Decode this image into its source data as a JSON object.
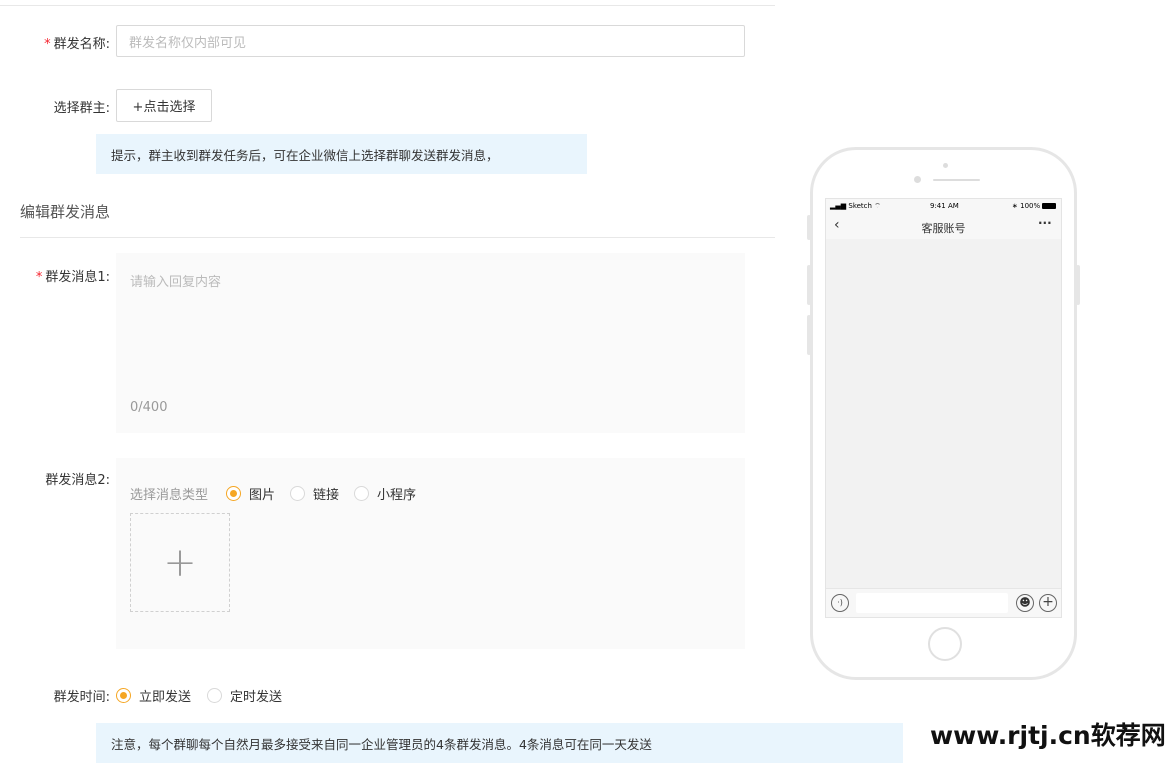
{
  "form": {
    "name_label": "群发名称:",
    "name_placeholder": "群发名称仅内部可见",
    "owner_label": "选择群主:",
    "owner_button": "+点击选择",
    "tip": "提示，群主收到群发任务后，可在企业微信上选择群聊发送群发消息，",
    "section_title": "编辑群发消息",
    "msg1_label": "群发消息1:",
    "msg1_placeholder": "请输入回复内容",
    "msg1_counter": "0/400",
    "msg2_label": "群发消息2:",
    "msg2_type_label": "选择消息类型",
    "msg2_types": [
      {
        "label": "图片",
        "selected": true
      },
      {
        "label": "链接",
        "selected": false
      },
      {
        "label": "小程序",
        "selected": false
      }
    ],
    "time_label": "群发时间:",
    "time_options": [
      {
        "label": "立即发送",
        "selected": true
      },
      {
        "label": "定时发送",
        "selected": false
      }
    ],
    "notice": "注意，每个群聊每个自然月最多接受来自同一企业管理员的4条群发消息。4条消息可在同一天发送",
    "required_mark": "*"
  },
  "phone": {
    "carrier": "Sketch",
    "time": "9:41 AM",
    "battery": "100%",
    "title": "客服账号"
  },
  "watermark": "www.rjtj.cn软荐网",
  "colors": {
    "accent": "#f5a623",
    "tip_bg": "#e9f5fd",
    "required": "#f5222d"
  }
}
